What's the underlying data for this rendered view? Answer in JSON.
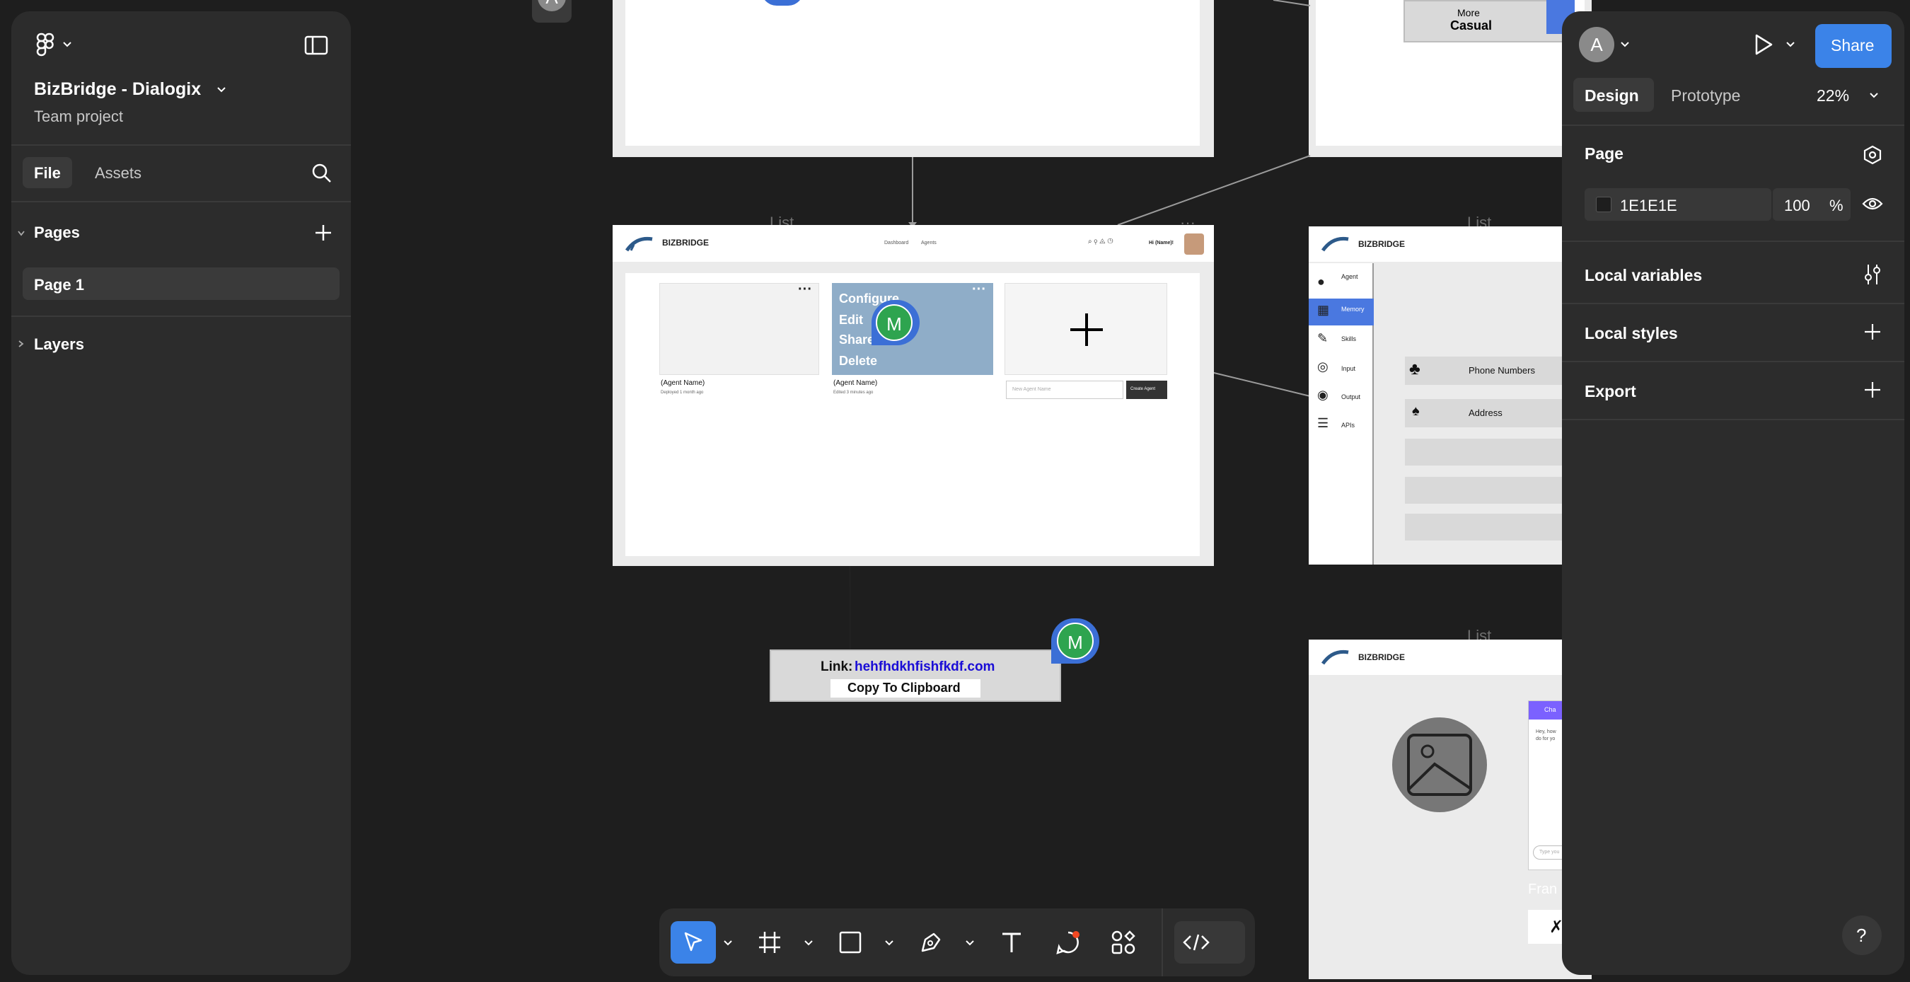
{
  "left_panel": {
    "project_name": "BizBridge - Dialogix",
    "team": "Team project",
    "tabs": [
      "File",
      "Assets"
    ],
    "pages_header": "Pages",
    "pages": [
      "Page 1"
    ],
    "layers_header": "Layers"
  },
  "right_panel": {
    "avatar_letter": "A",
    "share_label": "Share",
    "tabs": [
      "Design",
      "Prototype"
    ],
    "zoom": "22%",
    "page_title": "Page",
    "bg_color_hex": "1E1E1E",
    "bg_opacity": "100",
    "percent_sign": "%",
    "sections": [
      "Local variables",
      "Local styles",
      "Export"
    ],
    "help_label": "?"
  },
  "canvas": {
    "cursor_user": "A",
    "collab_initial": "M",
    "frame_label": "List",
    "top_right_frame": {
      "more_label": "More",
      "casual_label": "Casual",
      "more_label2": "More"
    },
    "dashboard": {
      "brand": "BIZBRIDGE",
      "nav": [
        "Dashboard",
        "Agents"
      ],
      "greeting": "Hi (Name)!",
      "context_menu": [
        "Configure",
        "Edit",
        "Share",
        "Delete"
      ],
      "cards": [
        {
          "name": "(Agent Name)",
          "meta": "Deployed 1 month ago"
        },
        {
          "name": "(Agent Name)",
          "meta": "Edited 3 minutes ago"
        }
      ],
      "new_agent_placeholder": "New Agent Name",
      "create_button": "Create Agent"
    },
    "share_popup": {
      "link_label": "Link:",
      "link_value": "hehfhdkhfishfkdf.com",
      "copy_button": "Copy To Clipboard"
    },
    "memory_frame": {
      "brand": "BIZBRIDGE",
      "sidebar": [
        "Agent",
        "Memory",
        "Skills",
        "Input",
        "Output",
        "APIs"
      ],
      "items": [
        "Phone Numbers",
        "Address"
      ]
    },
    "chat_frame": {
      "brand": "BIZBRIDGE",
      "chat_title": "Cha",
      "chat_msg1": "Hey, how",
      "chat_msg2": "do for yo",
      "chat_input": "Type you",
      "frame_text": "Fran"
    }
  },
  "colors": {
    "canvas_bg": "#1e1e1e",
    "panel_bg": "#2c2c2c",
    "accent_blue": "#0d99ff",
    "share_button": "#3b83e8",
    "collab_green": "#2ea44f",
    "link_blue": "#1a0dd6",
    "card_blue": "#8fadc8"
  }
}
